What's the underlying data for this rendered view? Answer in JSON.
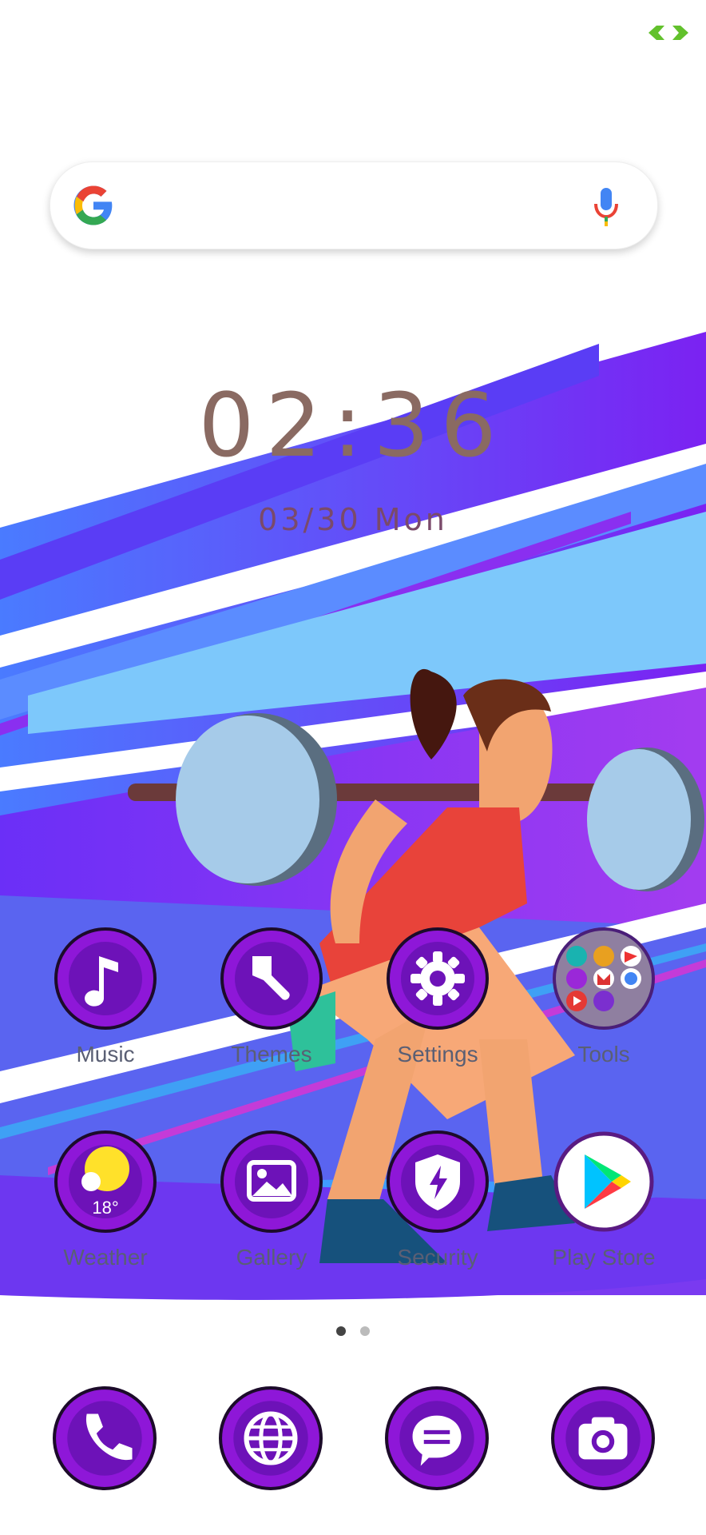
{
  "status": {
    "icon": "battery-charging-icon"
  },
  "search": {
    "logo": "google-g-icon",
    "mic": "mic-icon"
  },
  "clock": {
    "time": "02:36",
    "date": "03/30 Mon"
  },
  "apps_row1": [
    {
      "label": "Music",
      "icon": "music-note-icon"
    },
    {
      "label": "Themes",
      "icon": "paintbrush-icon"
    },
    {
      "label": "Settings",
      "icon": "gear-icon"
    },
    {
      "label": "Tools",
      "icon": "folder-icon"
    }
  ],
  "apps_row2": [
    {
      "label": "Weather",
      "icon": "weather-icon",
      "temp": "18°"
    },
    {
      "label": "Gallery",
      "icon": "image-icon"
    },
    {
      "label": "Security",
      "icon": "shield-icon"
    },
    {
      "label": "Play Store",
      "icon": "play-store-icon"
    }
  ],
  "pager": {
    "pages": 2,
    "active": 1
  },
  "dock": [
    {
      "icon": "phone-icon"
    },
    {
      "icon": "globe-icon"
    },
    {
      "icon": "message-icon"
    },
    {
      "icon": "camera-icon"
    }
  ],
  "colors": {
    "accent": "#8e17d8",
    "clock": "#8a6a62"
  }
}
